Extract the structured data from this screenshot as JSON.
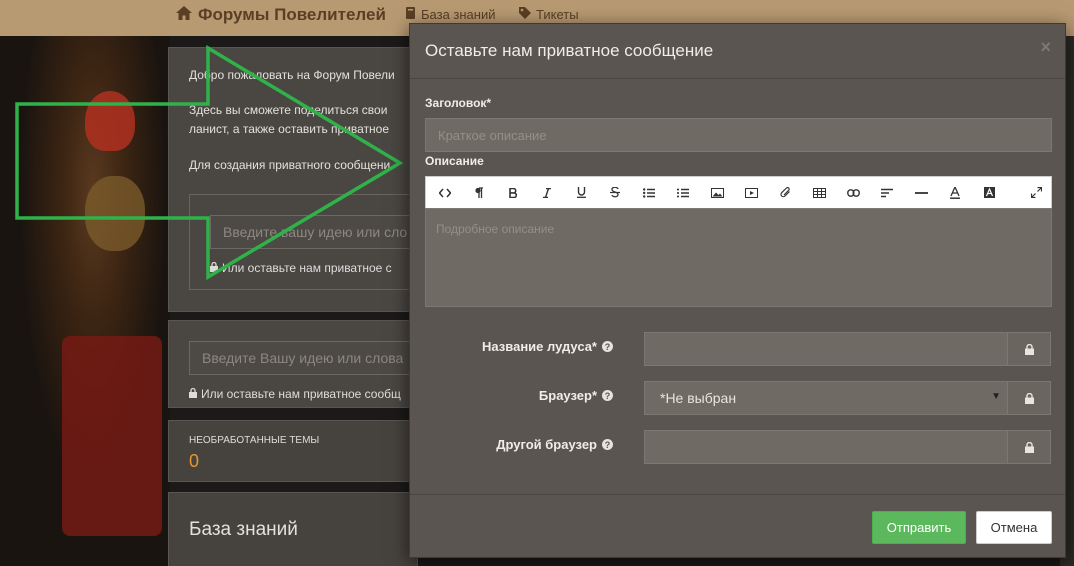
{
  "navbar": {
    "brand": "Форумы Повелителей",
    "links": [
      "База знаний",
      "Тикеты"
    ]
  },
  "background": {
    "welcome": "Добро пожаловать на Форум Повели",
    "line2": "Здесь вы сможете поделиться свои",
    "line3": "ланист, а также оставить приватное",
    "line4": "Для создания приватного сообщени",
    "input1_placeholder": "Введите вашу идею или сло",
    "note1": "Или оставьте нам приватное с",
    "input2_placeholder": "Введите Вашу идею или слова",
    "note2": "Или оставьте нам приватное сообщ",
    "stat_label": "НЕОБРАБОТАННЫЕ ТЕМЫ",
    "stat_value": "0",
    "kb_title": "База знаний"
  },
  "modal": {
    "title": "Оставьте нам приватное сообщение",
    "close": "×",
    "subject_label": "Заголовок*",
    "subject_placeholder": "Краткое описание",
    "description_label": "Описание",
    "description_placeholder": "Подробное описание",
    "toolbar_icons": [
      "code-view-icon",
      "paragraph-icon",
      "bold-icon",
      "italic-icon",
      "underline-icon",
      "strikethrough-icon",
      "bullet-list-icon",
      "numbered-list-icon",
      "image-icon",
      "video-icon",
      "attach-icon",
      "table-icon",
      "link-icon",
      "align-icon",
      "horizontal-rule-icon",
      "font-color-icon",
      "background-color-icon",
      "fullscreen-icon"
    ],
    "fields": [
      {
        "label": "Название лудуса*",
        "value": ""
      },
      {
        "label": "Браузер*",
        "value": "*Не выбран"
      },
      {
        "label": "Другой браузер",
        "value": ""
      }
    ],
    "submit": "Отправить",
    "cancel": "Отмена"
  },
  "colors": {
    "navbar": "#b89a72",
    "modal_bg": "#5a5550",
    "submit": "#5cb85c",
    "accent": "#e8962e",
    "arrow": "#2fb24a"
  }
}
